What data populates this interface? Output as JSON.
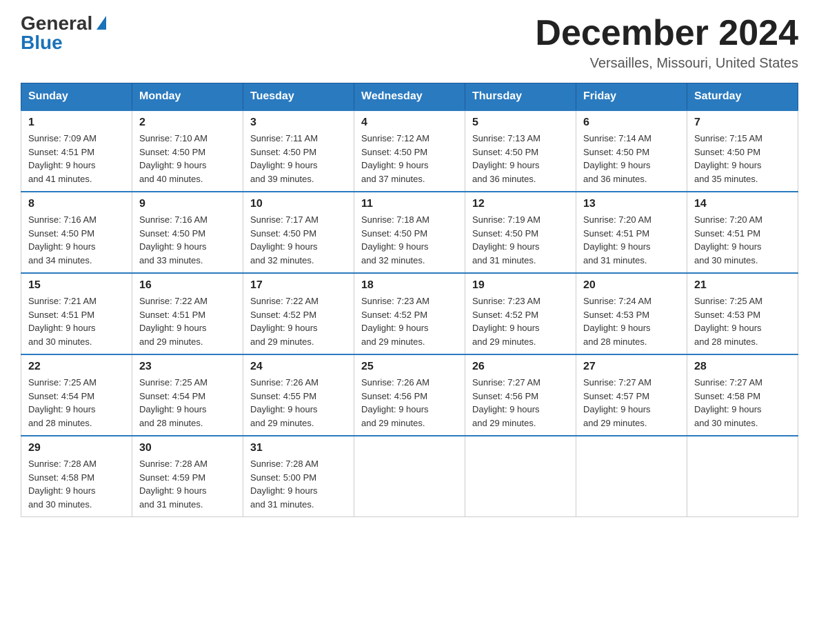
{
  "header": {
    "logo_general": "General",
    "logo_blue": "Blue",
    "month_title": "December 2024",
    "subtitle": "Versailles, Missouri, United States"
  },
  "weekdays": [
    "Sunday",
    "Monday",
    "Tuesday",
    "Wednesday",
    "Thursday",
    "Friday",
    "Saturday"
  ],
  "weeks": [
    [
      {
        "day": "1",
        "info": "Sunrise: 7:09 AM\nSunset: 4:51 PM\nDaylight: 9 hours\nand 41 minutes."
      },
      {
        "day": "2",
        "info": "Sunrise: 7:10 AM\nSunset: 4:50 PM\nDaylight: 9 hours\nand 40 minutes."
      },
      {
        "day": "3",
        "info": "Sunrise: 7:11 AM\nSunset: 4:50 PM\nDaylight: 9 hours\nand 39 minutes."
      },
      {
        "day": "4",
        "info": "Sunrise: 7:12 AM\nSunset: 4:50 PM\nDaylight: 9 hours\nand 37 minutes."
      },
      {
        "day": "5",
        "info": "Sunrise: 7:13 AM\nSunset: 4:50 PM\nDaylight: 9 hours\nand 36 minutes."
      },
      {
        "day": "6",
        "info": "Sunrise: 7:14 AM\nSunset: 4:50 PM\nDaylight: 9 hours\nand 36 minutes."
      },
      {
        "day": "7",
        "info": "Sunrise: 7:15 AM\nSunset: 4:50 PM\nDaylight: 9 hours\nand 35 minutes."
      }
    ],
    [
      {
        "day": "8",
        "info": "Sunrise: 7:16 AM\nSunset: 4:50 PM\nDaylight: 9 hours\nand 34 minutes."
      },
      {
        "day": "9",
        "info": "Sunrise: 7:16 AM\nSunset: 4:50 PM\nDaylight: 9 hours\nand 33 minutes."
      },
      {
        "day": "10",
        "info": "Sunrise: 7:17 AM\nSunset: 4:50 PM\nDaylight: 9 hours\nand 32 minutes."
      },
      {
        "day": "11",
        "info": "Sunrise: 7:18 AM\nSunset: 4:50 PM\nDaylight: 9 hours\nand 32 minutes."
      },
      {
        "day": "12",
        "info": "Sunrise: 7:19 AM\nSunset: 4:50 PM\nDaylight: 9 hours\nand 31 minutes."
      },
      {
        "day": "13",
        "info": "Sunrise: 7:20 AM\nSunset: 4:51 PM\nDaylight: 9 hours\nand 31 minutes."
      },
      {
        "day": "14",
        "info": "Sunrise: 7:20 AM\nSunset: 4:51 PM\nDaylight: 9 hours\nand 30 minutes."
      }
    ],
    [
      {
        "day": "15",
        "info": "Sunrise: 7:21 AM\nSunset: 4:51 PM\nDaylight: 9 hours\nand 30 minutes."
      },
      {
        "day": "16",
        "info": "Sunrise: 7:22 AM\nSunset: 4:51 PM\nDaylight: 9 hours\nand 29 minutes."
      },
      {
        "day": "17",
        "info": "Sunrise: 7:22 AM\nSunset: 4:52 PM\nDaylight: 9 hours\nand 29 minutes."
      },
      {
        "day": "18",
        "info": "Sunrise: 7:23 AM\nSunset: 4:52 PM\nDaylight: 9 hours\nand 29 minutes."
      },
      {
        "day": "19",
        "info": "Sunrise: 7:23 AM\nSunset: 4:52 PM\nDaylight: 9 hours\nand 29 minutes."
      },
      {
        "day": "20",
        "info": "Sunrise: 7:24 AM\nSunset: 4:53 PM\nDaylight: 9 hours\nand 28 minutes."
      },
      {
        "day": "21",
        "info": "Sunrise: 7:25 AM\nSunset: 4:53 PM\nDaylight: 9 hours\nand 28 minutes."
      }
    ],
    [
      {
        "day": "22",
        "info": "Sunrise: 7:25 AM\nSunset: 4:54 PM\nDaylight: 9 hours\nand 28 minutes."
      },
      {
        "day": "23",
        "info": "Sunrise: 7:25 AM\nSunset: 4:54 PM\nDaylight: 9 hours\nand 28 minutes."
      },
      {
        "day": "24",
        "info": "Sunrise: 7:26 AM\nSunset: 4:55 PM\nDaylight: 9 hours\nand 29 minutes."
      },
      {
        "day": "25",
        "info": "Sunrise: 7:26 AM\nSunset: 4:56 PM\nDaylight: 9 hours\nand 29 minutes."
      },
      {
        "day": "26",
        "info": "Sunrise: 7:27 AM\nSunset: 4:56 PM\nDaylight: 9 hours\nand 29 minutes."
      },
      {
        "day": "27",
        "info": "Sunrise: 7:27 AM\nSunset: 4:57 PM\nDaylight: 9 hours\nand 29 minutes."
      },
      {
        "day": "28",
        "info": "Sunrise: 7:27 AM\nSunset: 4:58 PM\nDaylight: 9 hours\nand 30 minutes."
      }
    ],
    [
      {
        "day": "29",
        "info": "Sunrise: 7:28 AM\nSunset: 4:58 PM\nDaylight: 9 hours\nand 30 minutes."
      },
      {
        "day": "30",
        "info": "Sunrise: 7:28 AM\nSunset: 4:59 PM\nDaylight: 9 hours\nand 31 minutes."
      },
      {
        "day": "31",
        "info": "Sunrise: 7:28 AM\nSunset: 5:00 PM\nDaylight: 9 hours\nand 31 minutes."
      },
      {
        "day": "",
        "info": ""
      },
      {
        "day": "",
        "info": ""
      },
      {
        "day": "",
        "info": ""
      },
      {
        "day": "",
        "info": ""
      }
    ]
  ]
}
